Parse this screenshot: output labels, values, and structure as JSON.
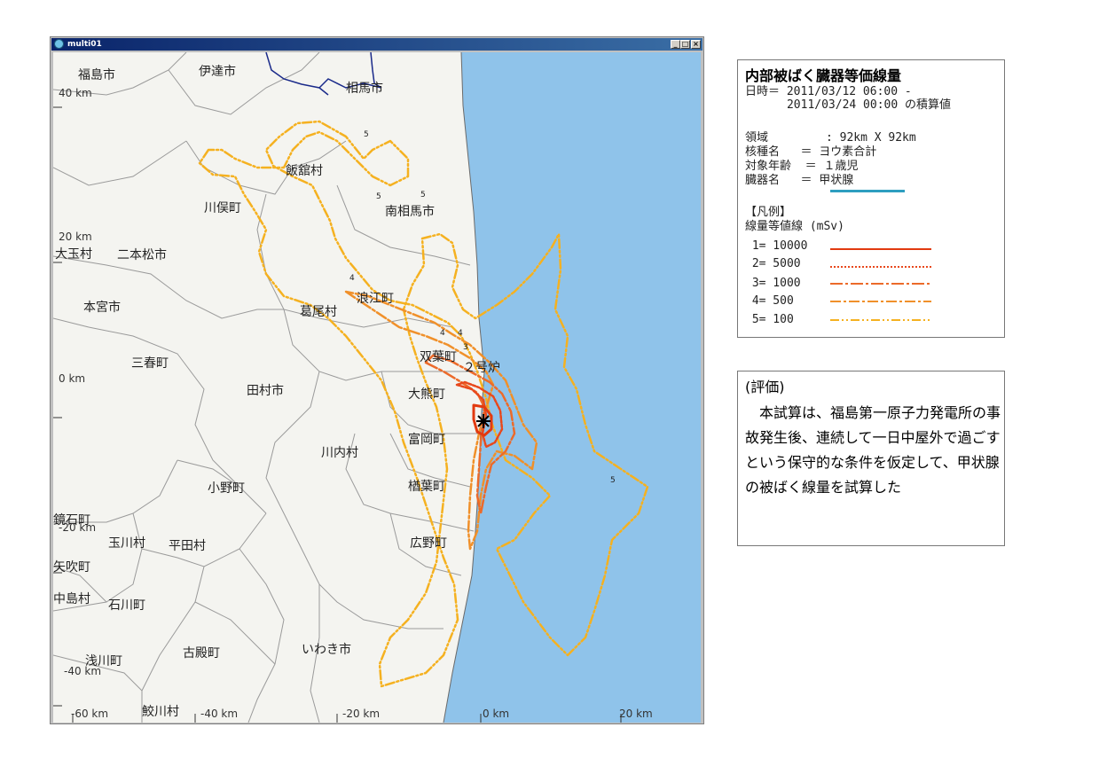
{
  "window": {
    "title": "multi01",
    "buttons": [
      "_",
      "□",
      "×"
    ]
  },
  "map": {
    "place_names": [
      {
        "id": "fukushima",
        "label": "福島市"
      },
      {
        "id": "date",
        "label": "伊達市"
      },
      {
        "id": "soma",
        "label": "相馬市"
      },
      {
        "id": "iitate",
        "label": "飯舘村"
      },
      {
        "id": "kawamata",
        "label": "川俣町"
      },
      {
        "id": "minamisoma",
        "label": "南相馬市"
      },
      {
        "id": "otama",
        "label": "大玉村"
      },
      {
        "id": "nihonmatsu",
        "label": "二本松市"
      },
      {
        "id": "namie",
        "label": "浪江町"
      },
      {
        "id": "katsurao",
        "label": "葛尾村"
      },
      {
        "id": "motomiya",
        "label": "本宮市"
      },
      {
        "id": "futaba",
        "label": "双葉町"
      },
      {
        "id": "miharu",
        "label": "三春町"
      },
      {
        "id": "okuma",
        "label": "大熊町"
      },
      {
        "id": "tamura",
        "label": "田村市"
      },
      {
        "id": "tomioka",
        "label": "富岡町"
      },
      {
        "id": "kawauchi",
        "label": "川内村"
      },
      {
        "id": "naraha",
        "label": "楢葉町"
      },
      {
        "id": "ono",
        "label": "小野町"
      },
      {
        "id": "kagamiishi",
        "label": "鏡石町"
      },
      {
        "id": "tamakawa",
        "label": "玉川村"
      },
      {
        "id": "hirata",
        "label": "平田村"
      },
      {
        "id": "hirono",
        "label": "広野町"
      },
      {
        "id": "yabuki",
        "label": "矢吹町"
      },
      {
        "id": "nakajima",
        "label": "中島村"
      },
      {
        "id": "ishikawa",
        "label": "石川町"
      },
      {
        "id": "iwaki",
        "label": "いわき市"
      },
      {
        "id": "asakawa",
        "label": "浅川町"
      },
      {
        "id": "furudono",
        "label": "古殿町"
      },
      {
        "id": "samegawa",
        "label": "鮫川村"
      }
    ],
    "reactor_label": "２号炉",
    "contour_labels": [
      "5",
      "5",
      "5",
      "4",
      "4",
      "4",
      "3",
      "5"
    ],
    "y_axis": [
      "40 km",
      "20 km",
      "0 km",
      "-20 km",
      "-40 km"
    ],
    "x_axis": [
      "-60 km",
      "-40 km",
      "-20 km",
      "0 km",
      "20 km"
    ],
    "colors": {
      "sea": "#8fc3ea",
      "land": "#f4f4f0",
      "boundary": "#9a9a9a",
      "river": "#1a2a8a",
      "c1": "#e23a10",
      "c2": "#e8481c",
      "c3": "#ec6a2a",
      "c4": "#f0902a",
      "c5": "#f5b120"
    }
  },
  "legend": {
    "title": "内部被ばく臓器等価線量",
    "datetime_label": "日時＝ 2011/03/12 06:00 -",
    "datetime_line2": "      2011/03/24 00:00 の積算値",
    "region_label": "領域",
    "region_value": "      : 92km X 92km",
    "nuclide": "核種名   ＝ ヨウ素合計",
    "age": "対象年齢  ＝ １歳児",
    "organ": "臓器名   ＝ 甲状腺",
    "key_header": "【凡例】",
    "contour_header": "線量等値線 (mSv)",
    "items": [
      {
        "label": " 1= 10000"
      },
      {
        "label": " 2= 5000"
      },
      {
        "label": " 3= 1000"
      },
      {
        "label": " 4= 500"
      },
      {
        "label": " 5= 100"
      }
    ]
  },
  "evaluation": {
    "heading": "(評価)",
    "body": "本試算は、福島第一原子力発電所の事故発生後、連続して一日中屋外で過ごすという保守的な条件を仮定して、甲状腺の被ばく線量を試算した"
  }
}
